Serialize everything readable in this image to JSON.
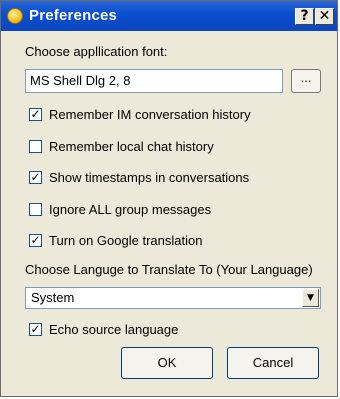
{
  "window": {
    "title": "Preferences",
    "help_glyph": "?",
    "close_glyph": "✕"
  },
  "font": {
    "label": "Choose appllication font:",
    "value": "MS Shell Dlg 2, 8",
    "browse_label": "..."
  },
  "options": [
    {
      "label": "Remember IM conversation history",
      "checked": true
    },
    {
      "label": "Remember local chat history",
      "checked": false
    },
    {
      "label": "Show timestamps in conversations",
      "checked": true
    },
    {
      "label": "Ignore ALL group messages",
      "checked": false
    },
    {
      "label": "Turn on Google translation",
      "checked": true
    }
  ],
  "language": {
    "label": "Choose Languge to Translate To (Your Language)",
    "selected": "System"
  },
  "echo": {
    "label": "Echo source language",
    "checked": true
  },
  "buttons": {
    "ok": "OK",
    "cancel": "Cancel"
  }
}
